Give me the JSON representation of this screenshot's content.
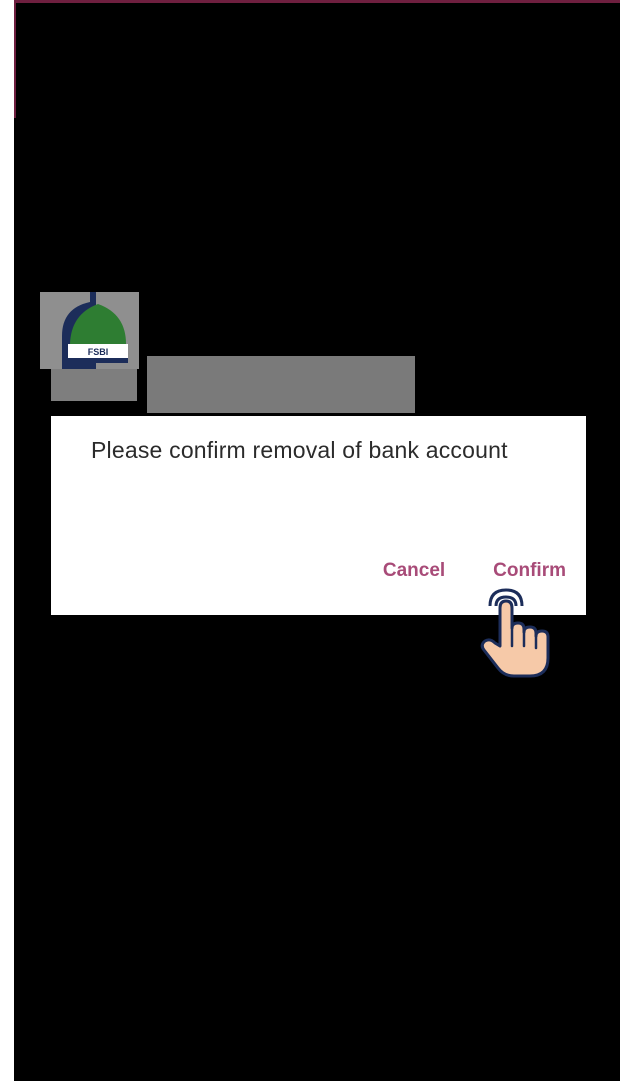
{
  "dialog": {
    "message": "Please confirm removal of bank account",
    "cancel_label": "Cancel",
    "confirm_label": "Confirm"
  },
  "logo": {
    "text": "FSBI"
  },
  "colors": {
    "accent": "#a84b78",
    "logo_green": "#2e7d32",
    "logo_navy": "#1c2d5a",
    "skin": "#f6c9a8"
  },
  "icons": {
    "logo": "bank-logo-icon",
    "tap_indicator": "pointing-hand-icon"
  }
}
